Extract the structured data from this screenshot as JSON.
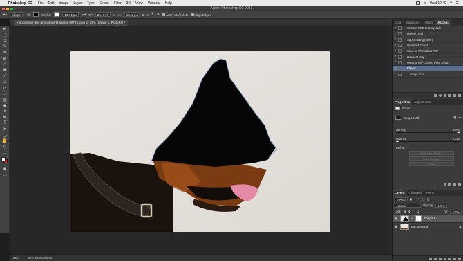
{
  "menubar": {
    "apple_glyph": "",
    "app_name": "Photoshop CC",
    "items": [
      "File",
      "Edit",
      "Image",
      "Layer",
      "Type",
      "Select",
      "Filter",
      "3D",
      "View",
      "Window",
      "Help"
    ],
    "clock": "Wed 12:49"
  },
  "window": {
    "title": "Adobe Photoshop CC 2018"
  },
  "options": {
    "shape_mode": "Shape",
    "fill_label": "Fill:",
    "stroke_label": "Stroke:",
    "stroke_width": "10.84 px",
    "w_label": "W:",
    "w_value": "2544.75",
    "h_label": "H:",
    "h_value": "1842 px",
    "auto_add_label": "Auto Add/Delete",
    "align_edges_label": "Align Edges"
  },
  "document": {
    "tab_label": "doberman-dog-animal-world-animal-89783.jpeg @ 25% (Shape 1, RGB/8#) *"
  },
  "status": {
    "zoom": "25%",
    "doc_info": "Doc: 36.0M/36.8M"
  },
  "tools": [
    {
      "name": "move-tool-icon",
      "glyph": "✥"
    },
    {
      "name": "marquee-tool-icon",
      "glyph": "⬚"
    },
    {
      "name": "lasso-tool-icon",
      "glyph": "ↄ"
    },
    {
      "name": "quick-select-tool-icon",
      "glyph": "✎"
    },
    {
      "name": "crop-tool-icon",
      "glyph": "⌗"
    },
    {
      "name": "frame-tool-icon",
      "glyph": "⊠"
    },
    {
      "name": "eyedropper-tool-icon",
      "glyph": "⁄"
    },
    {
      "name": "healing-brush-tool-icon",
      "glyph": "✚"
    },
    {
      "name": "brush-tool-icon",
      "glyph": "∕"
    },
    {
      "name": "clone-stamp-tool-icon",
      "glyph": "⊥"
    },
    {
      "name": "history-brush-tool-icon",
      "glyph": "↺"
    },
    {
      "name": "eraser-tool-icon",
      "glyph": "▭"
    },
    {
      "name": "gradient-tool-icon",
      "glyph": "▤"
    },
    {
      "name": "blur-tool-icon",
      "glyph": "◆"
    },
    {
      "name": "dodge-tool-icon",
      "glyph": "●"
    },
    {
      "name": "pen-tool-icon",
      "glyph": "✒"
    },
    {
      "name": "type-tool-icon",
      "glyph": "T"
    },
    {
      "name": "path-selection-tool-icon",
      "glyph": "➤"
    },
    {
      "name": "shape-tool-icon",
      "glyph": "▢"
    },
    {
      "name": "hand-tool-icon",
      "glyph": "✋"
    },
    {
      "name": "zoom-tool-icon",
      "glyph": "⚲"
    },
    {
      "name": "more-tools-icon",
      "glyph": "…"
    }
  ],
  "panels": {
    "top_tabs": [
      "Color",
      "Swatches",
      "History",
      "Actions"
    ],
    "actions": [
      {
        "label": "Custom RGB to Grayscale",
        "checked": true
      },
      {
        "label": "Molten Lead",
        "checked": true
      },
      {
        "label": "Sepia Toning (layer)",
        "checked": true
      },
      {
        "label": "Quadrant Colors",
        "checked": true
      },
      {
        "label": "Save as Photoshop PDF",
        "checked": true
      },
      {
        "label": "Gradient Map",
        "checked": true
      },
      {
        "label": "Mixer Brush Cloning Paint Setup",
        "checked": true
      },
      {
        "label": "Effects",
        "checked": true
      },
      {
        "label": "Image Size",
        "checked": true
      }
    ],
    "properties_tabs": [
      "Properties",
      "Adjustments"
    ],
    "properties": {
      "masks_label": "Masks",
      "shape_path_label": "Shape Path",
      "density_label": "Density:",
      "density_value": "100%",
      "feather_label": "Feather:",
      "feather_value": "0.0 px",
      "refine_label": "Refine:",
      "select_mask_button": "Select and Mask...",
      "color_range_button": "Color Range...",
      "invert_button": "Invert"
    },
    "layers_tabs": [
      "Layers",
      "Channels",
      "Paths"
    ],
    "layers": {
      "kind_label": "Kind",
      "blend_mode": "Normal",
      "opacity_label": "Opacity:",
      "opacity_value": "100%",
      "lock_label": "Lock:",
      "fill_label": "Fill:",
      "fill_value": "100%",
      "items": [
        {
          "name": "Shape 1",
          "selected": true
        },
        {
          "name": "Background",
          "selected": false
        }
      ]
    }
  },
  "colors": {
    "foreground": "#ffffff",
    "background": "#d4161b",
    "selection": "#5a6e8c"
  }
}
